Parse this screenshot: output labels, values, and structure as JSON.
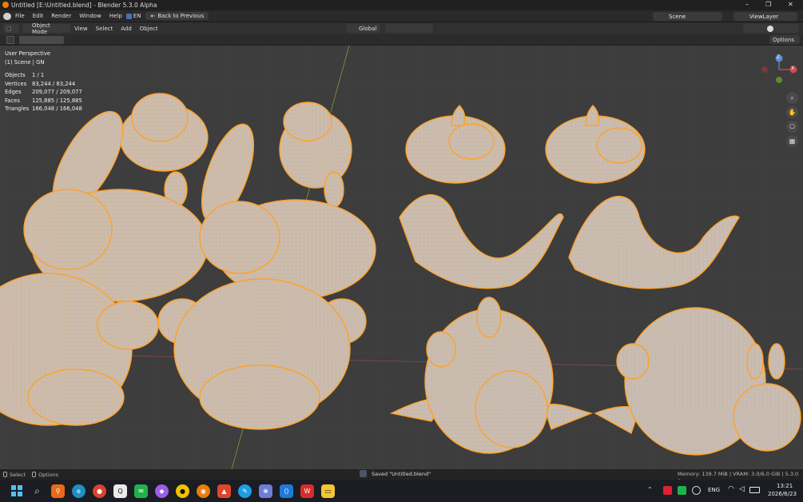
{
  "window": {
    "title": "Untitled [E:\\Untitled.blend] - Blender 5.3.0 Alpha",
    "min": "–",
    "max": "❐",
    "close": "✕"
  },
  "menubar": {
    "items": [
      "File",
      "Edit",
      "Render",
      "Window",
      "Help"
    ],
    "ime_label": "EN",
    "back_button": "Back to Previous",
    "scene_label": "Scene",
    "viewlayer_label": "ViewLayer"
  },
  "header": {
    "mode": "Object Mode",
    "menus": [
      "View",
      "Select",
      "Add",
      "Object"
    ],
    "transform_orientation": "Global",
    "options_label": "Options"
  },
  "viewport": {
    "perspective": "User Perspective",
    "scene_info": "(1) Scene | GN",
    "stats": [
      {
        "label": "Objects",
        "value": "1 / 1"
      },
      {
        "label": "Vertices",
        "value": "83,244 / 83,244"
      },
      {
        "label": "Edges",
        "value": "209,077 / 209,077"
      },
      {
        "label": "Faces",
        "value": "125,885 / 125,885"
      },
      {
        "label": "Triangles",
        "value": "166,048 / 166,048"
      }
    ],
    "gizmo": {
      "z": "Z",
      "x": "X"
    },
    "colors": {
      "background": "#3d3d3d",
      "mesh": "#c9bdb2",
      "wire": "#f29a2e",
      "select": "#ffa126"
    }
  },
  "statusbar": {
    "select": "Select",
    "options": "Options",
    "message": "Saved \"Untitled.blend\"",
    "memory": "Memory: 139.7 MiB | VRAM: 3.0/6.0 GiB | 5.3.0 a"
  },
  "taskbar": {
    "lang": "ENG",
    "time": "13:21",
    "date": "2026/6/23"
  }
}
